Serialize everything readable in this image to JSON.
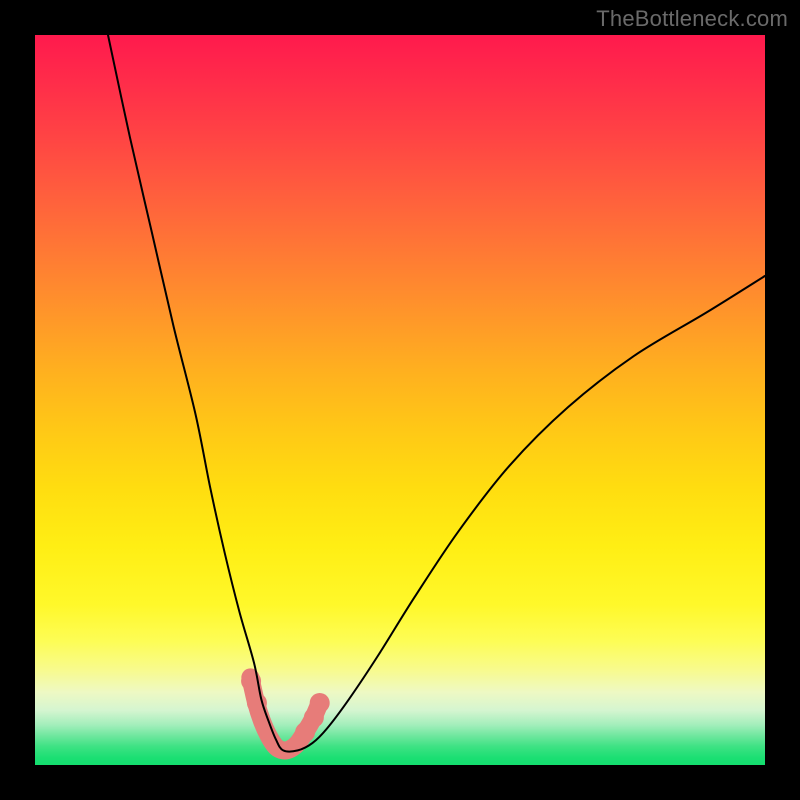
{
  "watermark": "TheBottleneck.com",
  "chart_data": {
    "type": "line",
    "title": "",
    "xlabel": "",
    "ylabel": "",
    "xlim": [
      0,
      100
    ],
    "ylim": [
      0,
      100
    ],
    "grid": false,
    "legend": false,
    "background": "rainbow-gradient-vertical",
    "series": [
      {
        "name": "bottleneck-curve",
        "color": "#000000",
        "x": [
          10,
          13,
          16,
          19,
          22,
          24,
          26,
          28,
          30,
          31,
          32,
          33,
          34,
          36,
          38,
          40,
          43,
          47,
          52,
          58,
          65,
          73,
          82,
          92,
          100
        ],
        "y": [
          100,
          86,
          73,
          60,
          48,
          38,
          29,
          21,
          14,
          9,
          6,
          3.5,
          2,
          2,
          3,
          5,
          9,
          15,
          23,
          32,
          41,
          49,
          56,
          62,
          67
        ]
      }
    ],
    "highlight": {
      "name": "optimal-range",
      "color": "#e77c79",
      "stroke_width": 18,
      "x": [
        29.5,
        30.3,
        31.1,
        32.0,
        33.0,
        34.0,
        35.0,
        36.0,
        37.0,
        38.0,
        39.0
      ],
      "y": [
        12.0,
        8.5,
        6.0,
        4.0,
        2.5,
        2.0,
        2.2,
        3.0,
        4.5,
        6.2,
        8.5
      ],
      "dots_x": [
        29.6,
        30.4,
        37.0,
        38.2,
        39.0
      ],
      "dots_y": [
        11.5,
        8.5,
        4.5,
        6.5,
        8.5
      ],
      "dot_radius": 10
    }
  }
}
